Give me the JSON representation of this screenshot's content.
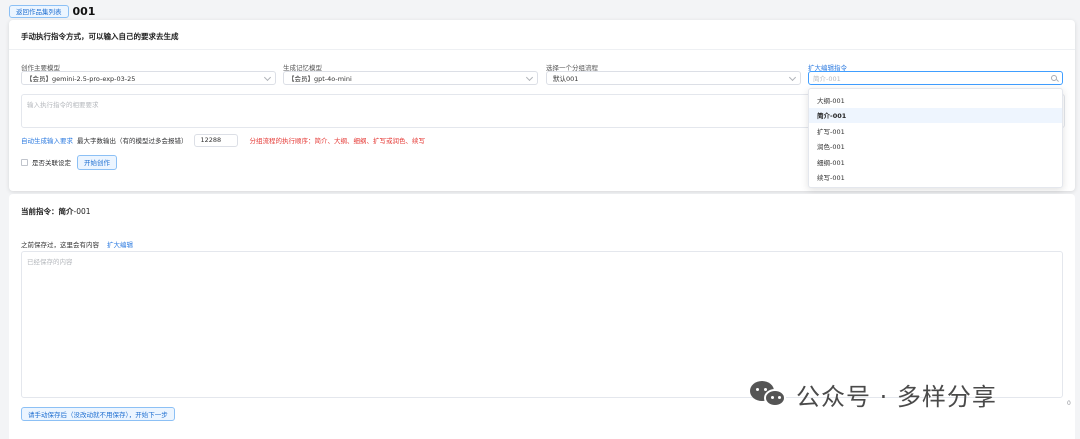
{
  "header": {
    "back_button": "返回作品集列表",
    "project_name": "001"
  },
  "manual": {
    "title": "手动执行指令方式，可以输入自己的要求去生成",
    "fields": {
      "main_model_label": "创作主要模型",
      "main_model_value": "【会员】gemini-2.5-pro-exp-03-25",
      "memory_model_label": "生成记忆模型",
      "memory_model_value": "【会员】gpt-4o-mini",
      "flow_label": "选择一个分组流程",
      "flow_value": "默认001",
      "expand_label": "扩大编辑指令",
      "expand_placeholder": "简介-001"
    },
    "requirement_placeholder": "输入执行指令的相要要求",
    "auto_input_link": "自动生成输入要求",
    "max_output_label": "最大字数输出（有的模型过多会报错）",
    "max_output_value": "12288",
    "flow_order_tip": "分组流程的执行顺序：简介、大纲、细纲、扩写或润色、续写",
    "relate_setting_label": "是否关联设定",
    "start_button": "开始创作"
  },
  "dropdown": {
    "items": [
      "大纲-001",
      "简介-001",
      "扩写-001",
      "润色-001",
      "细纲-001",
      "续写-001"
    ],
    "active": "简介-001"
  },
  "current": {
    "label": "当前指令：简介",
    "value": "-001",
    "saved_note": "之前保存过，这里会有内容",
    "expand_link": "扩大编辑",
    "saved_placeholder": "已经保存的内容",
    "char_count": "0",
    "next_button": "请手动保存后（没改动就不用保存），开始下一步"
  },
  "watermark": {
    "text": "公众号 · 多样分享",
    "icon": "wechat-icon"
  }
}
